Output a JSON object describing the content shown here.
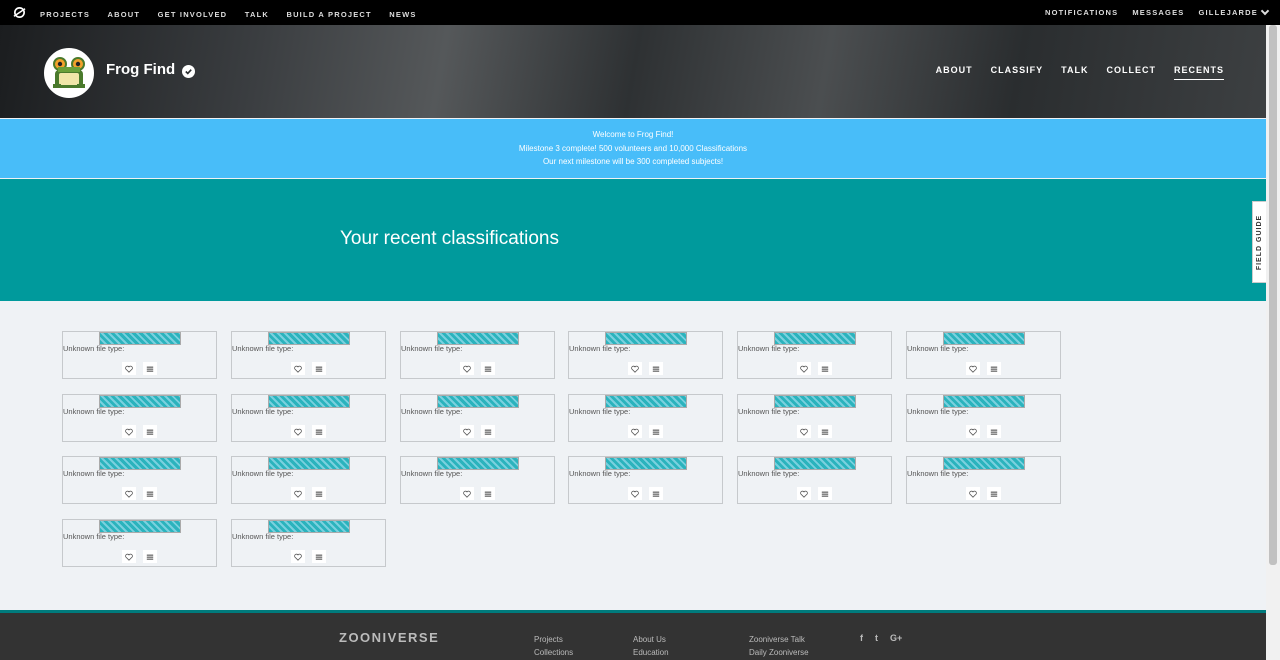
{
  "topbar": {
    "logo_icon": "zooniverse-logo-icon",
    "nav": [
      "PROJECTS",
      "ABOUT",
      "GET INVOLVED",
      "TALK",
      "BUILD A PROJECT",
      "NEWS"
    ],
    "right": {
      "notifications": "NOTIFICATIONS",
      "messages": "MESSAGES",
      "user": "GILLEJARDE"
    }
  },
  "project": {
    "title": "Frog Find",
    "nav": [
      "ABOUT",
      "CLASSIFY",
      "TALK",
      "COLLECT",
      "RECENTS"
    ],
    "active_nav": "RECENTS"
  },
  "announcement": {
    "line1": "Welcome to Frog Find!",
    "line2": "Milestone 3 complete! 500 volunteers and 10,000 Classifications",
    "line3": "Our next milestone will be 300 completed subjects!"
  },
  "hero": {
    "heading": "Your recent classifications"
  },
  "field_guide": {
    "label": "FIELD GUIDE"
  },
  "recents": {
    "item_label": "Unknown file type:",
    "items": [
      {
        "label": "Unknown file type:"
      },
      {
        "label": "Unknown file type:"
      },
      {
        "label": "Unknown file type:"
      },
      {
        "label": "Unknown file type:"
      },
      {
        "label": "Unknown file type:"
      },
      {
        "label": "Unknown file type:"
      },
      {
        "label": "Unknown file type:"
      },
      {
        "label": "Unknown file type:"
      },
      {
        "label": "Unknown file type:"
      },
      {
        "label": "Unknown file type:"
      },
      {
        "label": "Unknown file type:"
      },
      {
        "label": "Unknown file type:"
      },
      {
        "label": "Unknown file type:"
      },
      {
        "label": "Unknown file type:"
      },
      {
        "label": "Unknown file type:"
      },
      {
        "label": "Unknown file type:"
      },
      {
        "label": "Unknown file type:"
      },
      {
        "label": "Unknown file type:"
      },
      {
        "label": "Unknown file type:"
      },
      {
        "label": "Unknown file type:"
      }
    ]
  },
  "footer": {
    "brand": "ZOONIVERSE",
    "col1": [
      "Projects",
      "Collections"
    ],
    "col2": [
      "About Us",
      "Education"
    ],
    "col3": [
      "Zooniverse Talk",
      "Daily Zooniverse"
    ],
    "social": [
      "f",
      "t",
      "G+"
    ]
  },
  "colors": {
    "announcement_bg": "#48bdf9",
    "hero_bg": "#009a9c",
    "page_bg": "#eff2f5",
    "topbar_bg": "#000000",
    "footer_bg": "#333333"
  }
}
